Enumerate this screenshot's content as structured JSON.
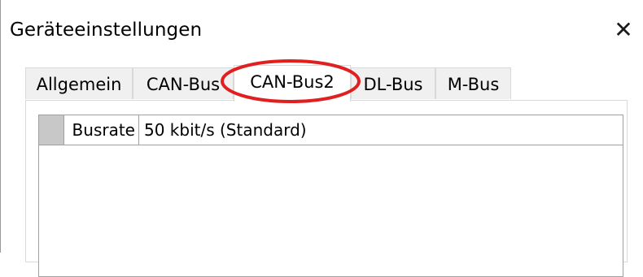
{
  "window": {
    "title": "Geräteeinstellungen",
    "close_symbol": "✕"
  },
  "tabs": [
    {
      "label": "Allgemein",
      "active": false
    },
    {
      "label": "CAN-Bus",
      "active": false
    },
    {
      "label": "CAN-Bus2",
      "active": true
    },
    {
      "label": "DL-Bus",
      "active": false
    },
    {
      "label": "M-Bus",
      "active": false
    }
  ],
  "grid": {
    "rows": [
      {
        "name": "Busrate",
        "value": "50 kbit/s (Standard)"
      }
    ]
  },
  "colors": {
    "annotation": "#e02020",
    "row_header": "#c8c8c8",
    "tab_inactive": "#f0f0f0"
  }
}
